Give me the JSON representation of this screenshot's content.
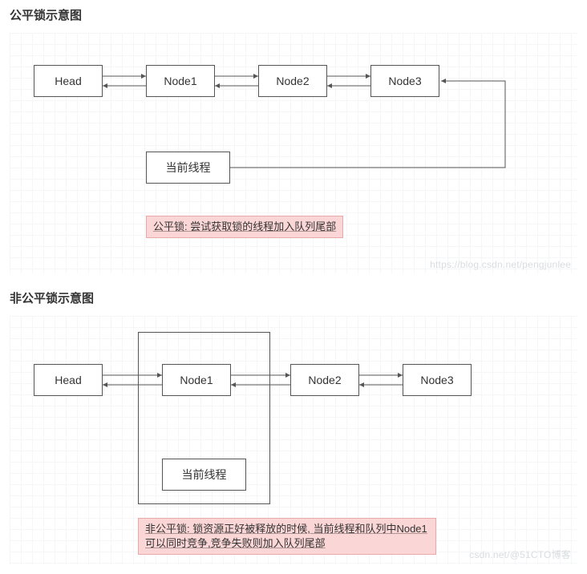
{
  "fair": {
    "title": "公平锁示意图",
    "nodes": {
      "head": "Head",
      "n1": "Node1",
      "n2": "Node2",
      "n3": "Node3",
      "current": "当前线程"
    },
    "note": "公平锁: 尝试获取锁的线程加入队列尾部",
    "watermark": "https://blog.csdn.net/pengjunlee"
  },
  "unfair": {
    "title": "非公平锁示意图",
    "nodes": {
      "head": "Head",
      "n1": "Node1",
      "n2": "Node2",
      "n3": "Node3",
      "current": "当前线程"
    },
    "note": "非公平锁: 锁资源正好被释放的时候, 当前线程和队列中Node1可以同时竞争,竞争失败则加入队列尾部",
    "watermark": "csdn.net/@51CTO博客"
  },
  "chart_data": [
    {
      "type": "diagram",
      "title": "公平锁示意图 (Fair lock schematic)",
      "nodes": [
        "Head",
        "Node1",
        "Node2",
        "Node3",
        "当前线程"
      ],
      "edges_bidirectional": [
        [
          "Head",
          "Node1"
        ],
        [
          "Node1",
          "Node2"
        ],
        [
          "Node2",
          "Node3"
        ]
      ],
      "edges_directed": [
        [
          "当前线程",
          "Node3 (tail)"
        ]
      ],
      "annotation": "公平锁: 尝试获取锁的线程加入队列尾部"
    },
    {
      "type": "diagram",
      "title": "非公平锁示意图 (Unfair lock schematic)",
      "nodes": [
        "Head",
        "Node1",
        "Node2",
        "Node3",
        "当前线程"
      ],
      "edges_bidirectional": [
        [
          "Head",
          "Node1"
        ],
        [
          "Node1",
          "Node2"
        ],
        [
          "Node2",
          "Node3"
        ]
      ],
      "grouping": [
        "Node1",
        "当前线程"
      ],
      "annotation": "非公平锁: 锁资源正好被释放的时候, 当前线程和队列中Node1可以同时竞争,竞争失败则加入队列尾部"
    }
  ]
}
